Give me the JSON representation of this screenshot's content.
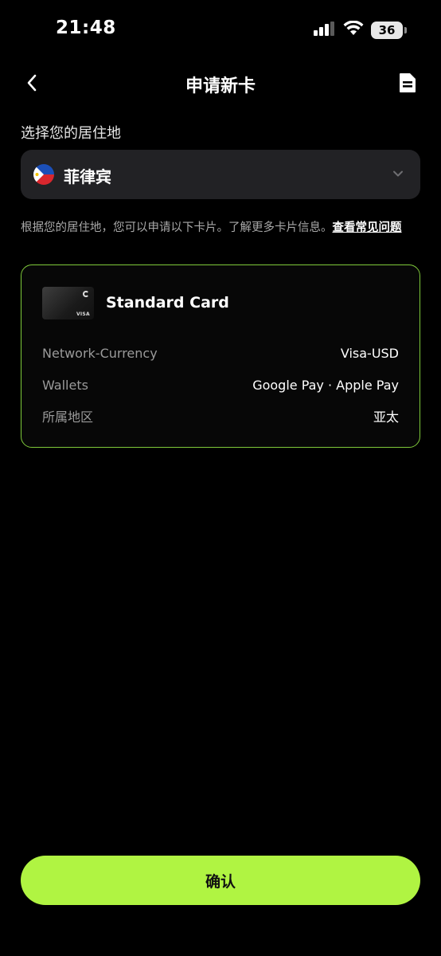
{
  "status": {
    "time": "21:48",
    "battery": "36",
    "icons": [
      "signal-icon",
      "wifi-icon",
      "battery-icon"
    ]
  },
  "nav": {
    "title": "申请新卡",
    "back_icon": "chevron-left-icon",
    "doc_icon": "document-icon"
  },
  "residence": {
    "label": "选择您的居住地",
    "selected_country": "菲律宾",
    "flag_icon": "philippines-flag-icon"
  },
  "info": {
    "text": "根据您的居住地，您可以申请以下卡片。了解更多卡片信息。",
    "link": "查看常见问题"
  },
  "card": {
    "name": "Standard Card",
    "thumb_brand": "VISA",
    "rows": [
      {
        "key": "Network-Currency",
        "value": "Visa-USD"
      },
      {
        "key": "Wallets",
        "value": "Google Pay · Apple Pay"
      },
      {
        "key": "所属地区",
        "value": "亚太"
      }
    ]
  },
  "confirm_label": "确认",
  "colors": {
    "accent": "#b0f442",
    "card_border": "#7fc93a",
    "background": "#000000",
    "select_bg": "#222225"
  }
}
